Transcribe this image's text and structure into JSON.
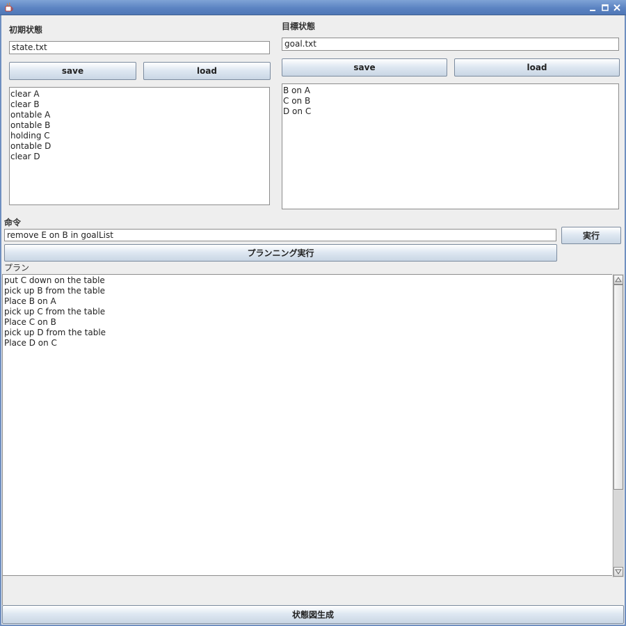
{
  "window": {
    "title": "",
    "icon": "java-cup-icon",
    "controls": {
      "minimize": "_",
      "maximize": "□",
      "close": "✕"
    }
  },
  "initial_state": {
    "label": "初期状態",
    "filename": "state.txt",
    "save_label": "save",
    "load_label": "load",
    "items": [
      "clear A",
      "clear B",
      "ontable A",
      "ontable B",
      "holding C",
      "ontable D",
      "clear D"
    ]
  },
  "goal_state": {
    "label": "目標状態",
    "filename": "goal.txt",
    "save_label": "save",
    "load_label": "load",
    "items": [
      "B on A",
      "C on B",
      "D on C"
    ]
  },
  "command": {
    "label": "命令",
    "value": "remove E on B in goalList",
    "execute_label": "実行",
    "planning_label": "プランニング実行"
  },
  "plan": {
    "label": "プラン",
    "items": [
      "put C down on the table",
      "pick up B from the table",
      "Place B on A",
      "pick up C from the table",
      "Place C on B",
      "pick up D from the table",
      "Place D on C"
    ]
  },
  "footer": {
    "generate_label": "状態図生成"
  }
}
